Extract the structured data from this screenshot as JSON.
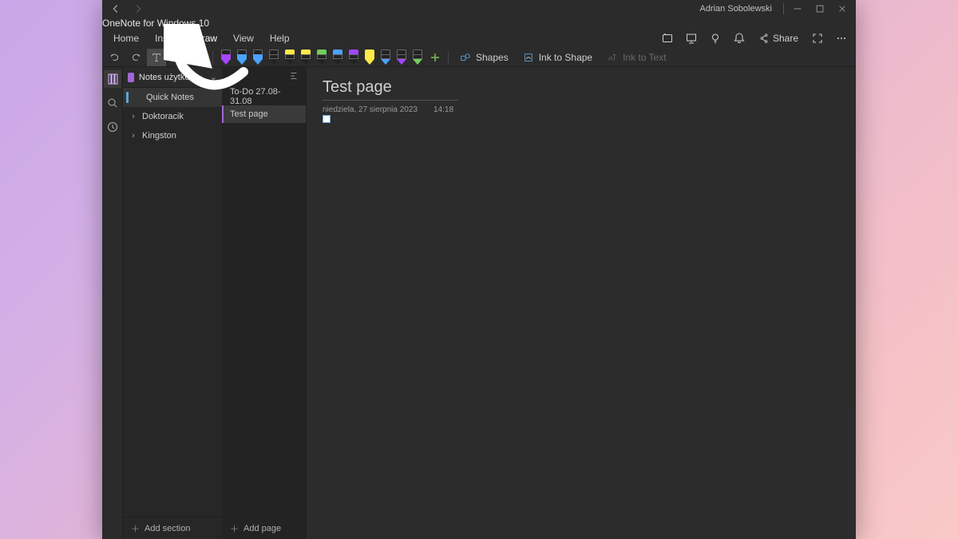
{
  "titlebar": {
    "app_title": "OneNote for Windows 10",
    "user": "Adrian Sobolewski"
  },
  "menu": {
    "items": [
      "Home",
      "Insert",
      "Draw",
      "View",
      "Help"
    ],
    "active_index": 2,
    "share_label": "Share"
  },
  "ribbon": {
    "pens": [
      {
        "cap": "#222",
        "body": "#a445ff",
        "tip": "#a445ff",
        "name": "pen-purple"
      },
      {
        "cap": "#222",
        "body": "#4aa3ff",
        "tip": "#4aa3ff",
        "name": "pen-blue"
      },
      {
        "cap": "#222",
        "body": "#4aa3ff",
        "tip": "#4aa3ff",
        "name": "pen-blue-2"
      },
      {
        "cap": "#222",
        "body": "#222",
        "tip": "#222",
        "name": "pen-black"
      },
      {
        "cap": "#ffe94a",
        "body": "#222",
        "tip": "#222",
        "name": "highlighter-yellow"
      },
      {
        "cap": "#ffe94a",
        "body": "#222",
        "tip": "#222",
        "name": "highlighter-yellow-2"
      },
      {
        "cap": "#6fcf5a",
        "body": "#222",
        "tip": "#222",
        "name": "highlighter-green"
      },
      {
        "cap": "#4aa3ff",
        "body": "#222",
        "tip": "#222",
        "name": "highlighter-blue"
      },
      {
        "cap": "#a445ff",
        "body": "#222",
        "tip": "#222",
        "name": "highlighter-purple"
      },
      {
        "cap": "#ffe94a",
        "body": "#ffe94a",
        "tip": "#ffe94a",
        "name": "highlighter-solid-yellow"
      },
      {
        "cap": "#222",
        "body": "#222",
        "tip": "#4aa3ff",
        "name": "pen-blue-tip"
      },
      {
        "cap": "#222",
        "body": "#222",
        "tip": "#a445ff",
        "name": "pen-purple-tip"
      },
      {
        "cap": "#222",
        "body": "#222",
        "tip": "#6fcf5a",
        "name": "pen-green-tip"
      }
    ],
    "shapes_label": "Shapes",
    "ink_to_shape_label": "Ink to Shape",
    "ink_to_text_label": "Ink to Text"
  },
  "notebook": {
    "name": "Notes użytkownika Adrian"
  },
  "sections": {
    "items": [
      {
        "label": "Quick Notes",
        "active": true,
        "expandable": false,
        "color": "#5aa7d8"
      },
      {
        "label": "Doktoracik",
        "active": false,
        "expandable": true
      },
      {
        "label": "Kingston",
        "active": false,
        "expandable": true
      }
    ],
    "add_label": "Add section"
  },
  "pages": {
    "items": [
      {
        "label": "To-Do 27.08-31.08",
        "active": false
      },
      {
        "label": "Test page",
        "active": true
      }
    ],
    "add_label": "Add page"
  },
  "canvas": {
    "title": "Test page",
    "date": "niedziela, 27 sierpnia 2023",
    "time": "14:18"
  }
}
